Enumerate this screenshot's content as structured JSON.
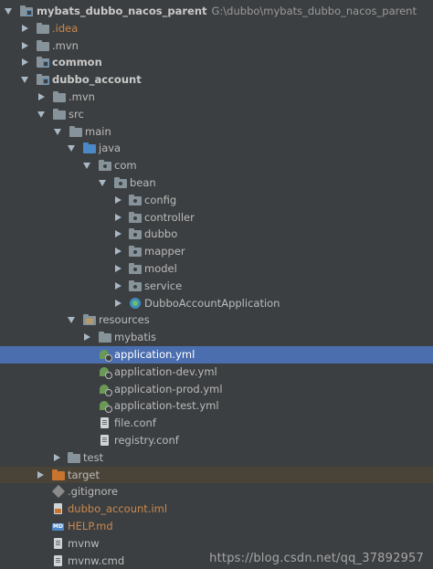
{
  "project": {
    "name": "mybats_dubbo_nacos_parent",
    "path": "G:\\dubbo\\mybats_dubbo_nacos_parent"
  },
  "tree": {
    "idea": ".idea",
    "mvn_root": ".mvn",
    "common": "common",
    "dubbo_account": "dubbo_account",
    "mvn_module": ".mvn",
    "src": "src",
    "main": "main",
    "java": "java",
    "com": "com",
    "bean": "bean",
    "config": "config",
    "controller": "controller",
    "dubbo": "dubbo",
    "mapper": "mapper",
    "model": "model",
    "service": "service",
    "app_class": "DubboAccountApplication",
    "resources": "resources",
    "mybatis": "mybatis",
    "application_yml": "application.yml",
    "application_dev": "application-dev.yml",
    "application_prod": "application-prod.yml",
    "application_test": "application-test.yml",
    "file_conf": "file.conf",
    "registry_conf": "registry.conf",
    "test": "test",
    "target": "target",
    "gitignore": ".gitignore",
    "iml": "dubbo_account.iml",
    "help": "HELP.md",
    "mvnw": "mvnw",
    "mvnw_cmd": "mvnw.cmd"
  },
  "icons": {
    "md_badge": "MD"
  },
  "watermark": "https://blog.csdn.net/qq_37892957"
}
